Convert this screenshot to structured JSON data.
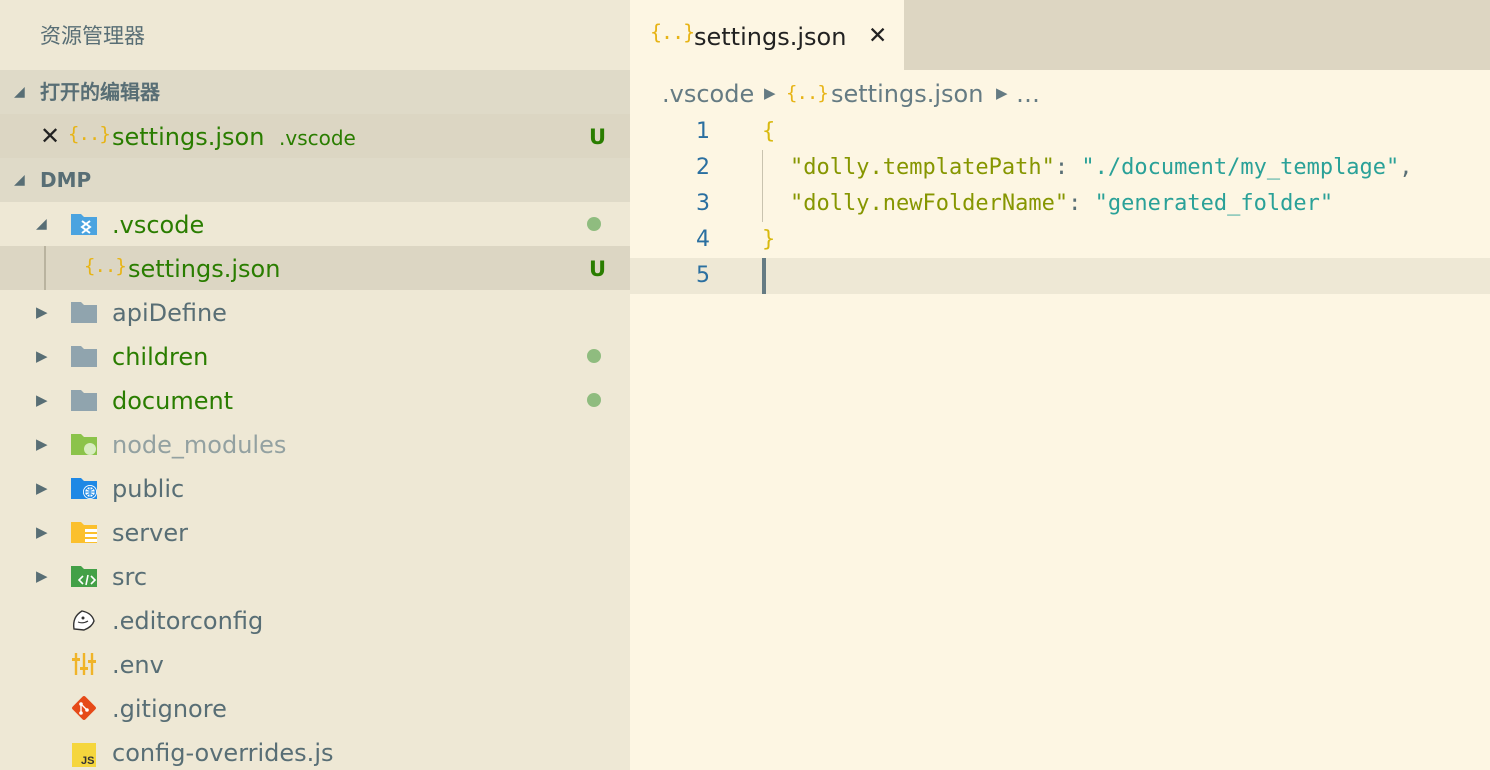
{
  "sidebar": {
    "title": "资源管理器",
    "open_editors": {
      "header": "打开的编辑器",
      "items": [
        {
          "name": "settings.json",
          "folder": ".vscode",
          "status": "U"
        }
      ]
    },
    "workspace": {
      "header": "DMP",
      "items": [
        {
          "label": ".vscode",
          "kind": "folder-vscode",
          "expanded": true,
          "modified": true
        },
        {
          "label": "settings.json",
          "kind": "json",
          "status": "U",
          "selected": true
        },
        {
          "label": "apiDefine",
          "kind": "folder",
          "expanded": false,
          "modified": false
        },
        {
          "label": "children",
          "kind": "folder",
          "expanded": false,
          "modified": true
        },
        {
          "label": "document",
          "kind": "folder",
          "expanded": false,
          "modified": true
        },
        {
          "label": "node_modules",
          "kind": "folder-node",
          "expanded": false,
          "ignored": true
        },
        {
          "label": "public",
          "kind": "folder-public",
          "expanded": false
        },
        {
          "label": "server",
          "kind": "folder-server",
          "expanded": false
        },
        {
          "label": "src",
          "kind": "folder-src",
          "expanded": false
        },
        {
          "label": ".editorconfig",
          "kind": "editorconfig"
        },
        {
          "label": ".env",
          "kind": "env"
        },
        {
          "label": ".gitignore",
          "kind": "git"
        },
        {
          "label": "config-overrides.js",
          "kind": "js"
        }
      ]
    }
  },
  "editor": {
    "tab": {
      "icon": "{..}",
      "label": "settings.json"
    },
    "breadcrumb": {
      "folder": ".vscode",
      "file": "settings.json",
      "more": "…"
    },
    "lines": [
      {
        "n": "1",
        "text": "{"
      },
      {
        "n": "2",
        "key": "\"dolly.templatePath\"",
        "colon": ": ",
        "value": "\"./document/my_templage\"",
        "comma": ","
      },
      {
        "n": "3",
        "key": "\"dolly.newFolderName\"",
        "colon": ": ",
        "value": "\"generated_folder\"",
        "comma": ""
      },
      {
        "n": "4",
        "text": "}"
      },
      {
        "n": "5",
        "text": ""
      }
    ]
  },
  "icons": {
    "json": "{..}",
    "js": "JS",
    "close": "✕"
  },
  "colors": {
    "sidebar_bg": "#eee8d5",
    "editor_bg": "#fdf6e3",
    "git_green": "#2a7d00",
    "modified_dot": "#8fbc7f",
    "json_icon": "#e7b416"
  }
}
